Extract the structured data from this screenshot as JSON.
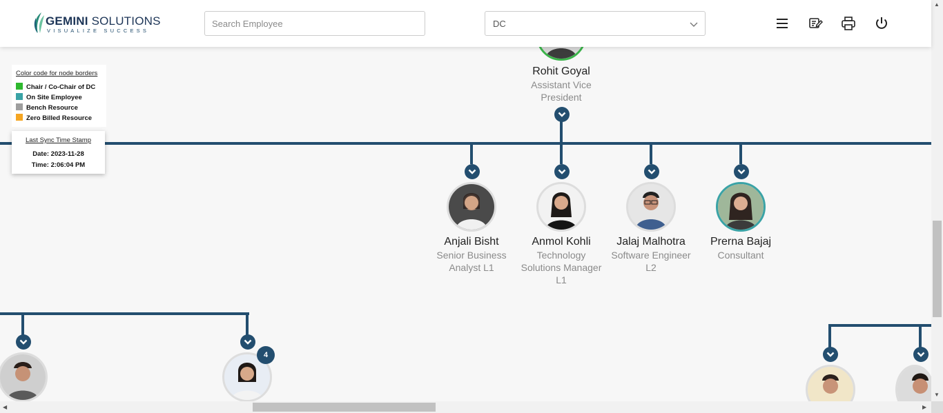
{
  "header": {
    "logo_main": "GEMINI",
    "logo_sub": "SOLUTIONS",
    "logo_tagline": "VISUALIZE SUCCESS",
    "search_placeholder": "Search Employee",
    "department_select": "DC",
    "icons": [
      "menu-icon",
      "edit-note-icon",
      "print-icon",
      "power-icon"
    ]
  },
  "legend": {
    "title": "Color code for node borders",
    "items": [
      {
        "label": "Chair / Co-Chair of DC",
        "color": "#2eb82e"
      },
      {
        "label": "On Site Employee",
        "color": "#3aa3a6"
      },
      {
        "label": "Bench Resource",
        "color": "#9e9e9e"
      },
      {
        "label": "Zero Billed Resource",
        "color": "#f5a623"
      }
    ]
  },
  "sync": {
    "title": "Last Sync Time Stamp",
    "date": "Date: 2023-11-28",
    "time": "Time: 2:06:04 PM"
  },
  "root": {
    "name": "Rohit Goyal",
    "title": "Assistant Vice President",
    "border": "green"
  },
  "children": [
    {
      "name": "Anjali Bisht",
      "title": "Senior Business Analyst L1",
      "border": "none"
    },
    {
      "name": "Anmol Kohli",
      "title": "Technology Solutions Manager L1",
      "border": "none"
    },
    {
      "name": "Jalaj Malhotra",
      "title": "Software Engineer L2",
      "border": "none"
    },
    {
      "name": "Prerna Bajaj",
      "title": "Consultant",
      "border": "teal"
    }
  ],
  "lower_nodes": {
    "badge_count": "4"
  },
  "colors": {
    "connector": "#234e6f",
    "chair": "#2eb82e",
    "onsite": "#3aa3a6"
  }
}
